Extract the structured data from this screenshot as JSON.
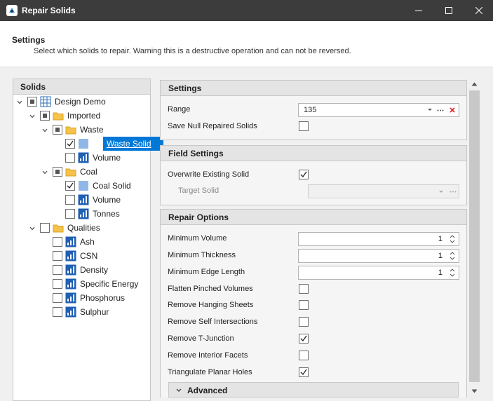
{
  "window": {
    "title": "Repair Solids",
    "controls": [
      "minimize",
      "maximize",
      "close"
    ]
  },
  "header": {
    "title": "Settings",
    "subtitle": "Select which solids to repair. Warning this is a destructive operation and can not be reversed."
  },
  "tree": {
    "header": "Solids",
    "items": [
      {
        "label": "Design Demo",
        "state": "partial",
        "icon": "grid-icon",
        "expanded": true
      },
      {
        "label": "Imported",
        "state": "partial",
        "icon": "folder-icon",
        "expanded": true
      },
      {
        "label": "Waste",
        "state": "partial",
        "icon": "folder-icon",
        "expanded": true
      },
      {
        "label": "Waste Solid",
        "state": "checked",
        "icon": "solid-icon",
        "selected": true
      },
      {
        "label": "Volume",
        "state": "unchecked",
        "icon": "field-icon"
      },
      {
        "label": "Coal",
        "state": "partial",
        "icon": "folder-icon",
        "expanded": true
      },
      {
        "label": "Coal Solid",
        "state": "checked",
        "icon": "solid-icon"
      },
      {
        "label": "Volume",
        "state": "unchecked",
        "icon": "field-icon"
      },
      {
        "label": "Tonnes",
        "state": "unchecked",
        "icon": "field-icon"
      },
      {
        "label": "Qualities",
        "state": "unchecked",
        "icon": "folder-icon",
        "expanded": true
      },
      {
        "label": "Ash",
        "state": "unchecked",
        "icon": "field-icon"
      },
      {
        "label": "CSN",
        "state": "unchecked",
        "icon": "field-icon"
      },
      {
        "label": "Density",
        "state": "unchecked",
        "icon": "field-icon"
      },
      {
        "label": "Specific Energy",
        "state": "unchecked",
        "icon": "field-icon"
      },
      {
        "label": "Phosphorus",
        "state": "unchecked",
        "icon": "field-icon"
      },
      {
        "label": "Sulphur",
        "state": "unchecked",
        "icon": "field-icon"
      }
    ]
  },
  "settings": {
    "header": "Settings",
    "range_label": "Range",
    "range_value": "135",
    "save_null_label": "Save Null Repaired Solids",
    "save_null_checked": false
  },
  "field_settings": {
    "header": "Field Settings",
    "overwrite_label": "Overwrite Existing Solid",
    "overwrite_checked": true,
    "target_label": "Target Solid",
    "target_value": ""
  },
  "repair_options": {
    "header": "Repair Options",
    "min_volume_label": "Minimum Volume",
    "min_volume_value": "1",
    "min_thickness_label": "Minimum Thickness",
    "min_thickness_value": "1",
    "min_edge_label": "Minimum Edge Length",
    "min_edge_value": "1",
    "flatten_label": "Flatten Pinched Volumes",
    "flatten_checked": false,
    "hanging_label": "Remove Hanging Sheets",
    "hanging_checked": false,
    "self_int_label": "Remove Self Intersections",
    "self_int_checked": false,
    "tjunction_label": "Remove T-Junction",
    "tjunction_checked": true,
    "interior_label": "Remove Interior Facets",
    "interior_checked": false,
    "triangulate_label": "Triangulate Planar Holes",
    "triangulate_checked": true
  },
  "advanced": {
    "label": "Advanced"
  },
  "colors": {
    "titlebar": "#3c3c3c",
    "selection": "#0078d7",
    "folder": "#f5c34a",
    "solid": "#8fb8e8",
    "field": "#1f5fb4",
    "close_red": "#d42020"
  }
}
